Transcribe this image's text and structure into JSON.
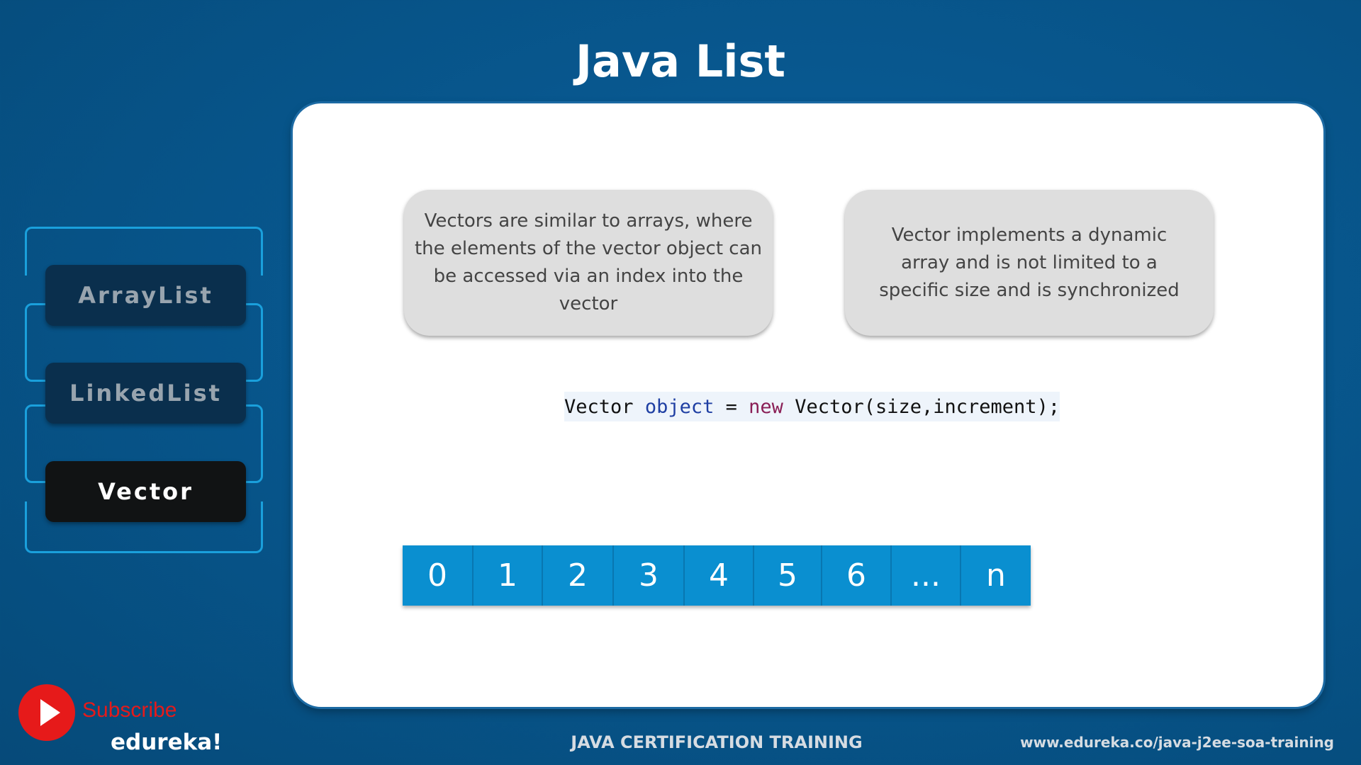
{
  "title": "Java List",
  "sidebar": {
    "items": [
      {
        "label": "ArrayList",
        "state": "inactive"
      },
      {
        "label": "LinkedList",
        "state": "inactive"
      },
      {
        "label": "Vector",
        "state": "active"
      }
    ]
  },
  "panel": {
    "info_left": "Vectors are similar to arrays, where the elements of the vector object can be accessed via an index into the vector",
    "info_right": "Vector implements a dynamic array and is not limited to a specific size and is synchronized",
    "code": {
      "type_name": "Vector",
      "variable": "object",
      "assign": "=",
      "keyword": "new",
      "constructor": "Vector(size,increment);"
    },
    "array_cells": [
      "0",
      "1",
      "2",
      "3",
      "4",
      "5",
      "6",
      "...",
      "n"
    ]
  },
  "footer": {
    "subscribe_label": "Subscribe",
    "brand": "edureka!",
    "course": "JAVA CERTIFICATION TRAINING",
    "url": "www.edureka.co/java-j2ee-soa-training"
  },
  "colors": {
    "background": "#075489",
    "accent_blue": "#0a8fd0",
    "subscribe_red": "#e61a1a",
    "active_tab": "#111314",
    "inactive_tab": "#0a2f4d"
  }
}
